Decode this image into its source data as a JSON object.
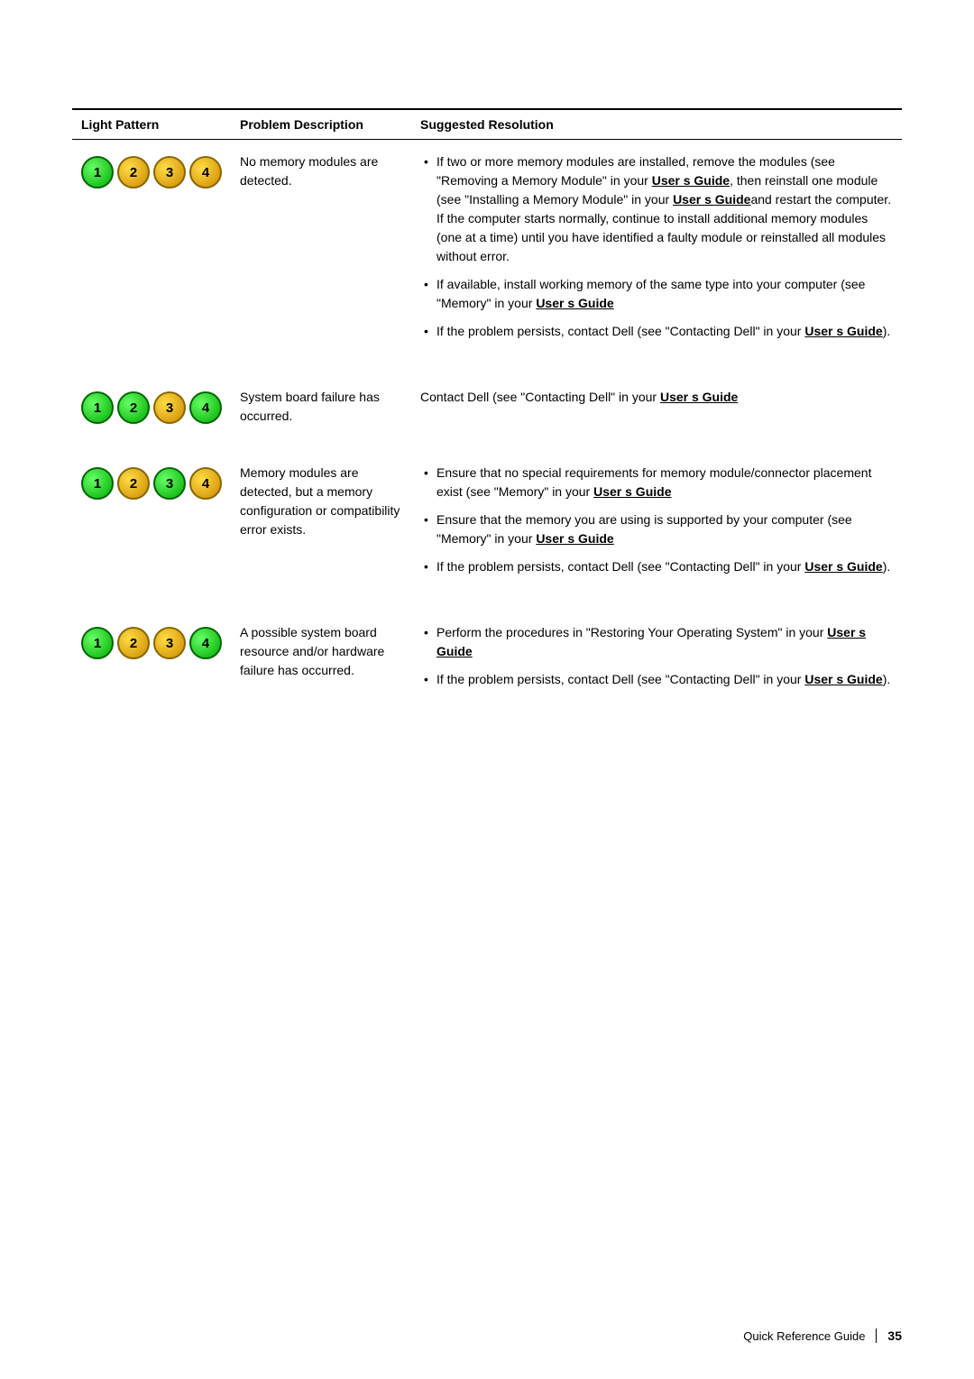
{
  "page": {
    "number": "35",
    "footer_label": "Quick Reference Guide",
    "footer_divider": "|"
  },
  "table": {
    "headers": {
      "col1": "Light Pattern",
      "col2": "Problem Description",
      "col3": "Suggested Resolution"
    },
    "rows": [
      {
        "id": "row1",
        "lights": [
          {
            "num": "1",
            "color": "green"
          },
          {
            "num": "2",
            "color": "amber"
          },
          {
            "num": "3",
            "color": "amber"
          },
          {
            "num": "4",
            "color": "amber"
          }
        ],
        "problem": "No memory modules are detected.",
        "resolution_type": "bullets",
        "bullets": [
          "If two or more memory modules are installed, remove the modules (see \"Removing a Memory Module\" in your User s Guide, then reinstall one module (see \"Installing a Memory Module\" in your User s Guideand restart the computer. If the computer starts normally, continue to install additional memory modules (one at a time) until you have identified a faulty module or reinstalled all modules without error.",
          "If available, install working memory of the same type into your computer (see \"Memory\" in your User s Guide",
          "If the problem persists, contact Dell (see \"Contacting Dell\" in your User s Guide)."
        ]
      },
      {
        "id": "row2",
        "lights": [
          {
            "num": "1",
            "color": "green"
          },
          {
            "num": "2",
            "color": "green"
          },
          {
            "num": "3",
            "color": "amber"
          },
          {
            "num": "4",
            "color": "green"
          }
        ],
        "problem": "System board failure has occurred.",
        "resolution_type": "plain",
        "plain": "Contact Dell (see \"Contacting Dell\" in your User s Guide"
      },
      {
        "id": "row3",
        "lights": [
          {
            "num": "1",
            "color": "green"
          },
          {
            "num": "2",
            "color": "amber"
          },
          {
            "num": "3",
            "color": "green"
          },
          {
            "num": "4",
            "color": "amber"
          }
        ],
        "problem": "Memory modules are detected, but a memory configuration or compatibility error exists.",
        "resolution_type": "bullets",
        "bullets": [
          "Ensure that no special requirements for memory module/connector placement exist (see \"Memory\" in your User s Guide",
          "Ensure that the memory you are using is supported by your computer (see \"Memory\" in your User s Guide",
          "If the problem persists, contact Dell (see \"Contacting Dell\" in your User s Guide)."
        ]
      },
      {
        "id": "row4",
        "lights": [
          {
            "num": "1",
            "color": "green"
          },
          {
            "num": "2",
            "color": "amber"
          },
          {
            "num": "3",
            "color": "amber"
          },
          {
            "num": "4",
            "color": "green"
          }
        ],
        "problem": "A possible system board resource and/or hardware failure has occurred.",
        "resolution_type": "bullets",
        "bullets": [
          "Perform the procedures in \"Restoring Your Operating System\" in your User s Guide",
          "If the problem persists, contact Dell (see \"Contacting Dell\" in your User s Guide)."
        ]
      }
    ]
  }
}
